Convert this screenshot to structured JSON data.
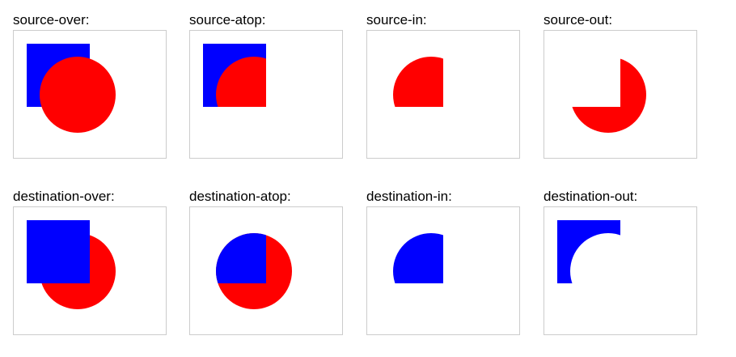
{
  "colors": {
    "destination": "#0000ff",
    "source": "#ff0000",
    "border": "#cccccc"
  },
  "modes": [
    {
      "id": "source-over",
      "label": "source-over:"
    },
    {
      "id": "source-atop",
      "label": "source-atop:"
    },
    {
      "id": "source-in",
      "label": "source-in:"
    },
    {
      "id": "source-out",
      "label": "source-out:"
    },
    {
      "id": "destination-over",
      "label": "destination-over:"
    },
    {
      "id": "destination-atop",
      "label": "destination-atop:"
    },
    {
      "id": "destination-in",
      "label": "destination-in:"
    },
    {
      "id": "destination-out",
      "label": "destination-out:"
    }
  ]
}
